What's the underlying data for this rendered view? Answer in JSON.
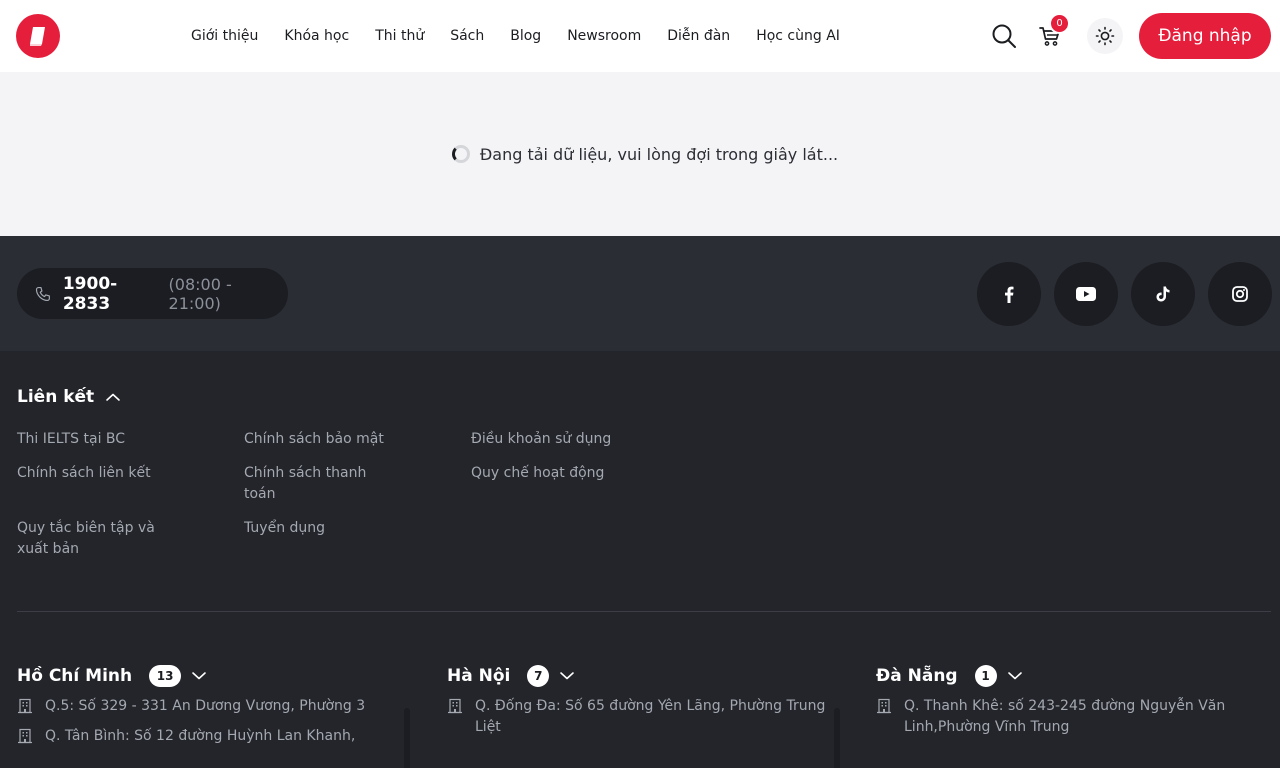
{
  "header": {
    "nav": [
      "Giới thiệu",
      "Khóa học",
      "Thi thử",
      "Sách",
      "Blog",
      "Newsroom",
      "Diễn đàn",
      "Học cùng AI"
    ],
    "cart_count": "0",
    "login_label": "Đăng nhập"
  },
  "loading": {
    "text": "Đang tải dữ liệu, vui lòng đợi trong giây lát..."
  },
  "footer": {
    "hotline_number": "1900-2833",
    "hotline_hours": "(08:00 - 21:00)",
    "links_title": "Liên kết",
    "links": [
      "Thi IELTS tại BC",
      "Chính sách bảo mật",
      "Điều khoản sử dụng",
      "Chính sách liên kết",
      "Chính sách thanh toán",
      "Quy chế hoạt động",
      "Quy tắc biên tập và xuất bản",
      "Tuyển dụng"
    ],
    "regions": [
      {
        "name": "Hồ Chí Minh",
        "count": "13",
        "addresses": [
          "Q.5: Số 329 - 331 An Dương Vương, Phường 3",
          "Q. Tân Bình: Số 12 đường Huỳnh Lan Khanh,"
        ]
      },
      {
        "name": "Hà Nội",
        "count": "7",
        "addresses": [
          "Q. Đống Đa: Số 65 đường Yên Lãng, Phường Trung Liệt"
        ]
      },
      {
        "name": "Đà Nẵng",
        "count": "1",
        "addresses": [
          "Q. Thanh Khê: số 243-245 đường Nguyễn Văn Linh,Phường Vĩnh Trung"
        ]
      }
    ]
  },
  "colors": {
    "brand": "#e51e3c",
    "footer_top": "#2a2d33",
    "footer_main": "#23252b"
  },
  "icons": [
    "book-logo-icon",
    "search-icon",
    "cart-icon",
    "sun-icon",
    "phone-icon",
    "facebook-icon",
    "youtube-icon",
    "tiktok-icon",
    "instagram-icon",
    "chevron-up-icon",
    "chevron-down-icon",
    "building-icon"
  ]
}
